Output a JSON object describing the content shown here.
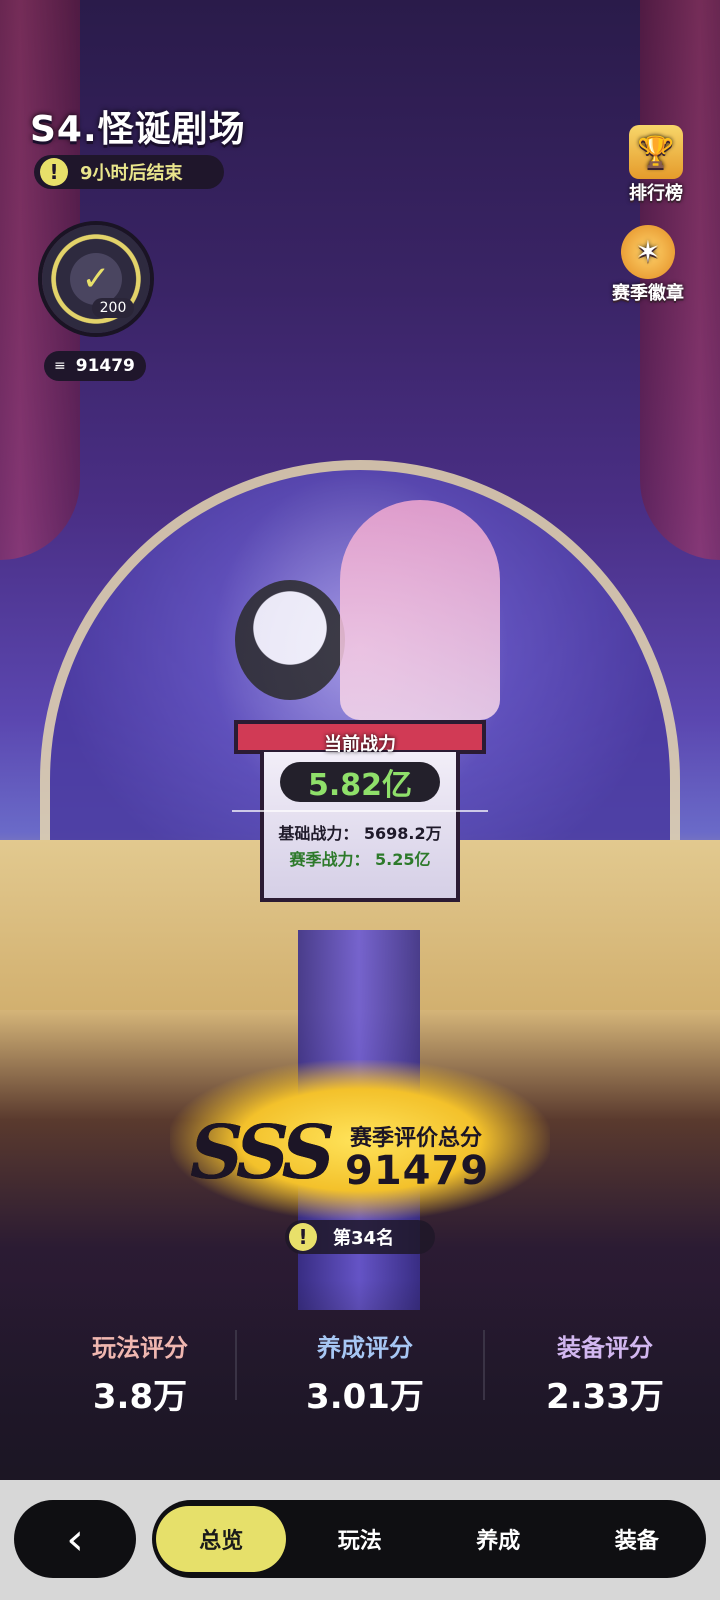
{
  "header": {
    "season_title": "S4.怪诞剧场",
    "timer_text": "9小时后结束"
  },
  "side_buttons": {
    "leaderboard": "排行榜",
    "season_badge": "赛季徽章"
  },
  "badge": {
    "count": "200",
    "points": "91479"
  },
  "podium": {
    "current_power_label": "当前战力",
    "current_power_value": "5.82亿",
    "base_power": "基础战力： 5698.2万",
    "season_power": "赛季战力： 5.25亿"
  },
  "season_score": {
    "grade": "SSS",
    "title": "赛季评价总分",
    "value": "91479",
    "rank": "第34名"
  },
  "stats": [
    {
      "label": "玩法评分",
      "value": "3.8万",
      "color": "#f0b7b0"
    },
    {
      "label": "养成评分",
      "value": "3.01万",
      "color": "#a7c7f4"
    },
    {
      "label": "装备评分",
      "value": "2.33万",
      "color": "#d2b7f0"
    }
  ],
  "bottom_nav": {
    "back_icon": "back-arrow-icon",
    "tabs": [
      "总览",
      "玩法",
      "养成",
      "装备"
    ],
    "active_tab": "总览"
  },
  "icons": {
    "timer": "alert-icon",
    "points": "list-icon",
    "rank": "alert-icon",
    "leaderboard": "trophy-icon",
    "season_badge": "medal-icon",
    "badge_check": "check-icon"
  },
  "colors": {
    "accent_yellow": "#e6e06a",
    "power_green": "#8fe06a",
    "bar_bg": "#0f0f12"
  }
}
